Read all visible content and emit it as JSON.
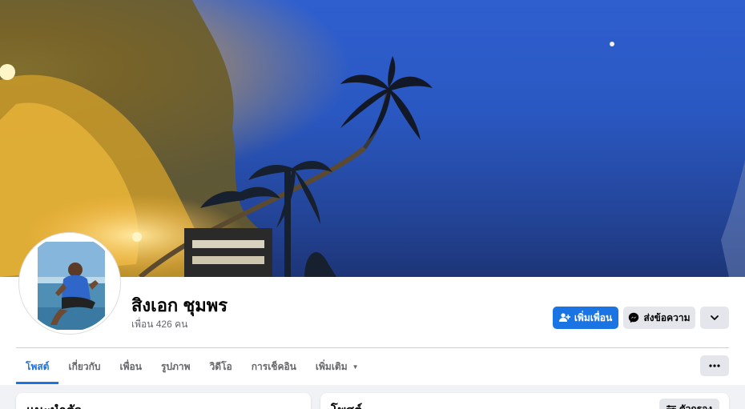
{
  "profile": {
    "name": "สิงเอก ชุมพร",
    "friends_count": "เพื่อน 426 คน"
  },
  "actions": {
    "add_friend": "เพิ่มเพื่อน",
    "message": "ส่งข้อความ",
    "add_friend_icon": "person-plus-icon",
    "message_icon": "messenger-icon",
    "more_icon": "chevron-down-icon"
  },
  "tabs": [
    {
      "label": "โพสต์",
      "active": true
    },
    {
      "label": "เกี่ยวกับ"
    },
    {
      "label": "เพื่อน"
    },
    {
      "label": "รูปภาพ"
    },
    {
      "label": "วิดีโอ"
    },
    {
      "label": "การเช็คอิน"
    },
    {
      "label": "เพิ่มเติม"
    }
  ],
  "sections": {
    "intro_title": "แนะนำตัว",
    "posts_title": "โพสต์",
    "filter_label": "ตัวกรอง"
  },
  "colors": {
    "accent": "#1b74e4",
    "background": "#f0f2f5",
    "secondary_button": "#e4e6eb"
  }
}
